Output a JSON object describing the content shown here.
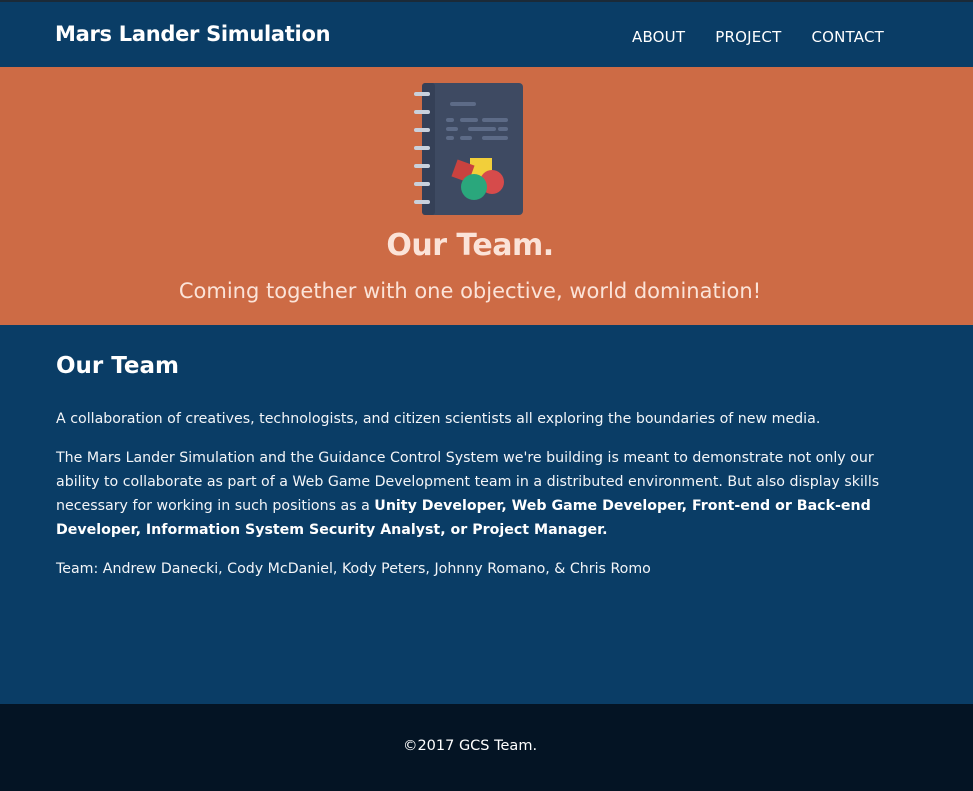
{
  "navbar": {
    "brand": "Mars Lander Simulation",
    "links": [
      {
        "label": "ABOUT"
      },
      {
        "label": "PROJECT"
      },
      {
        "label": "CONTACT"
      }
    ]
  },
  "hero": {
    "icon": "notebook-icon",
    "title": "Our Team.",
    "subtitle": "Coming together with one objective, world domination!"
  },
  "about": {
    "heading": "Our Team",
    "paragraph1": "A collaboration of creatives, technologists, and citizen scientists all exploring the boundaries of new media.",
    "paragraph2_text": "The Mars Lander Simulation and the Guidance Control System we're building is meant to demonstrate not only our ability to collaborate as part of a Web Game Development team in a distributed environment. But also display skills necessary for working in such positions as a ",
    "paragraph2_bold": "Unity Developer, Web Game Developer, Front-end or Back-end Developer, Information System Security Analyst, or Project Manager.",
    "team_line": "Team: Andrew Danecki, Cody McDaniel, Kody Peters, Johnny Romano, & Chris Romo"
  },
  "footer": {
    "copyright": "©2017 GCS Team."
  },
  "colors": {
    "nav_bg": "#0a3d66",
    "hero_bg": "#cd6b45",
    "content_bg": "#0a3d66",
    "footer_bg": "#041424",
    "hero_text": "#fbe3d8"
  }
}
